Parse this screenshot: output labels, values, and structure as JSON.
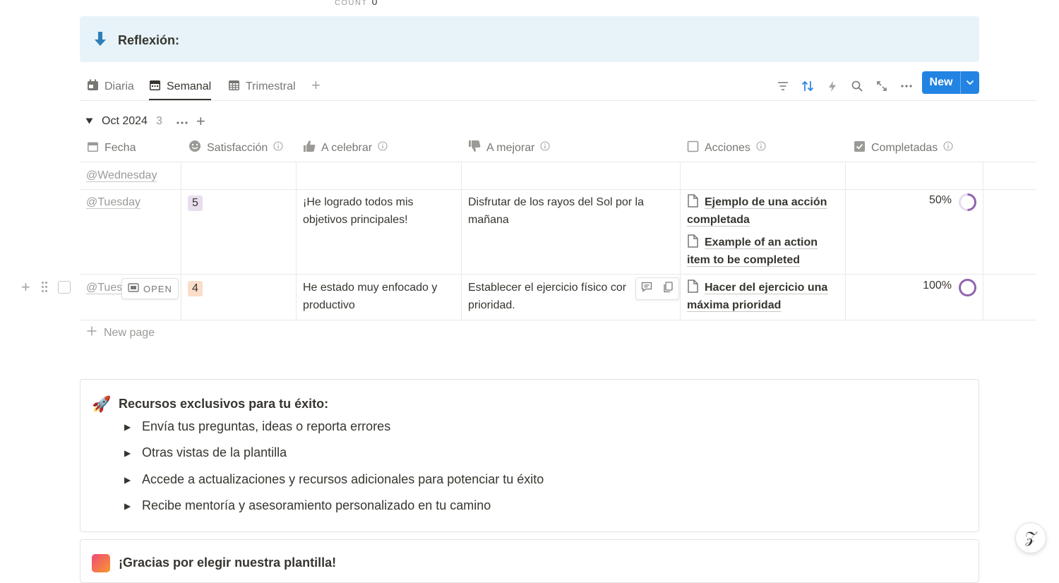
{
  "top_count": {
    "label": "COUNT",
    "value": "0"
  },
  "callout": {
    "title": "Reflexión:",
    "icon": "arrow-down-icon",
    "background": "#e7f3f8"
  },
  "tabs": [
    {
      "label": "Diaria",
      "icon": "calendar-icon"
    },
    {
      "label": "Semanal",
      "icon": "calendar-week-icon",
      "active": true
    },
    {
      "label": "Trimestral",
      "icon": "calendar-grid-icon"
    }
  ],
  "toolbar": {
    "icons": [
      "filter-icon",
      "sort-icon",
      "lightning-icon",
      "search-icon",
      "expand-icon",
      "more-icon"
    ],
    "new_label": "New",
    "accent": "#2383e2"
  },
  "group": {
    "name": "Oct 2024",
    "count": "3"
  },
  "columns": [
    {
      "label": "Fecha",
      "icon": "calendar-icon"
    },
    {
      "label": "Satisfacción",
      "icon": "smile-icon"
    },
    {
      "label": "A celebrar",
      "icon": "thumbs-up-icon"
    },
    {
      "label": "A mejorar",
      "icon": "thumbs-down-icon"
    },
    {
      "label": "Acciones",
      "icon": "checkbox-icon"
    },
    {
      "label": "Completadas",
      "icon": "checked-box-icon"
    }
  ],
  "rows": [
    {
      "date": "@Wednesday",
      "satisfaction": "",
      "celebrate": "",
      "improve": "",
      "actions": [],
      "completed": ""
    },
    {
      "date": "@Tuesday",
      "satisfaction": "5",
      "satisfaction_color": "#e8deee",
      "celebrate": "¡He logrado todos mis objetivos principales!",
      "improve": "Disfrutar de los rayos del Sol por la mañana",
      "actions": [
        "Ejemplo de una acción completada",
        "Example of an action item to be completed"
      ],
      "completed": "50%",
      "progress": 0.5
    },
    {
      "date": "@Tues",
      "open_label": "OPEN",
      "satisfaction": "4",
      "satisfaction_color": "#fadec9",
      "celebrate": "He estado muy enfocado y productivo",
      "improve": "Establecer el ejercicio físico cor prioridad.",
      "actions": [
        "Hacer del ejercicio una máxima prioridad"
      ],
      "completed": "100%",
      "progress": 1.0
    }
  ],
  "new_page_label": "New page",
  "resources": {
    "title": "Recursos exclusivos para tu éxito:",
    "items": [
      "Envía tus preguntas, ideas o reporta errores",
      "Otras vistas de la plantilla",
      "Accede a actualizaciones y recursos adicionales para potenciar tu éxito",
      "Recibe mentoría y asesoramiento personalizado en tu camino"
    ]
  },
  "thanks": {
    "title": "¡Gracias por elegir nuestra plantilla!"
  },
  "progress_color": "#9065b0"
}
